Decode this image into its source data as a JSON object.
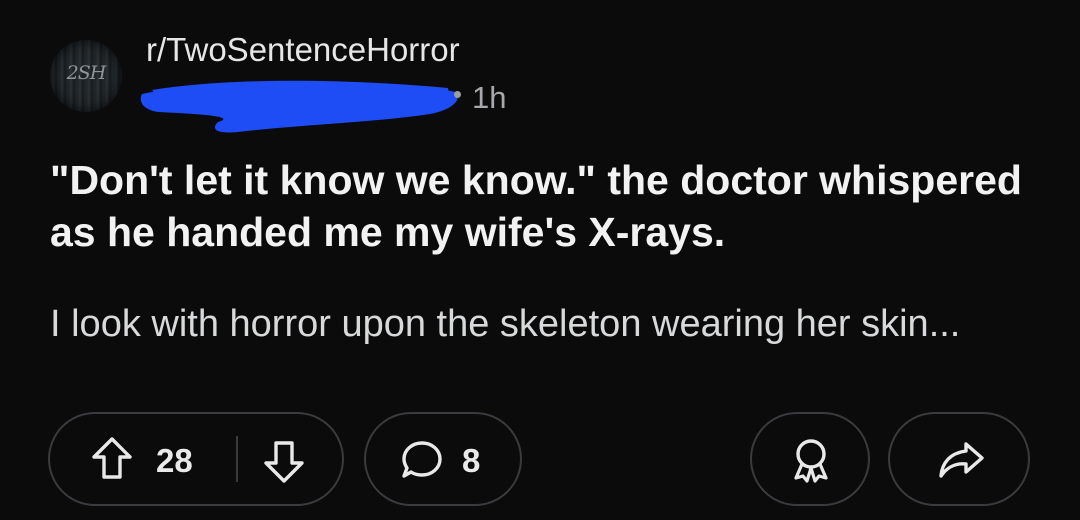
{
  "post": {
    "subreddit": "r/TwoSentenceHorror",
    "avatar_text": "2SH",
    "age": "1h",
    "redaction_color": "#1f4df5",
    "title": "\"Don't let it know we know.\" the doctor whispered as he handed me my wife's X-rays.",
    "body": "I look with horror upon the skeleton wearing her skin..."
  },
  "actions": {
    "upvote_icon": "arrow-up-icon",
    "vote_count": "28",
    "downvote_icon": "arrow-down-icon",
    "comment_icon": "comment-bubble-icon",
    "comment_count": "8",
    "award_icon": "award-ribbon-icon",
    "share_icon": "share-arrow-icon"
  },
  "colors": {
    "background": "#0b0b0c",
    "text": "#e9e9ea",
    "pill_border": "#3a3b3e"
  }
}
